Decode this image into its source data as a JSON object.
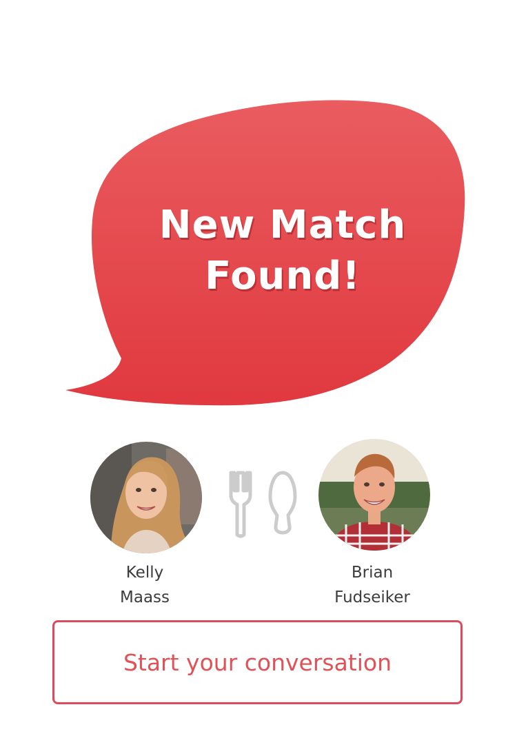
{
  "match": {
    "headline": "New Match\nFound!"
  },
  "people": [
    {
      "first_name": "Kelly",
      "last_name": "Maass",
      "avatar": "kelly-photo"
    },
    {
      "first_name": "Brian",
      "last_name": "Fudseiker",
      "avatar": "brian-photo"
    }
  ],
  "icons": {
    "center": "fork-and-spoon-icon"
  },
  "actions": {
    "start_label": "Start your conversation"
  },
  "colors": {
    "bubble_red": "#e3464d",
    "accent_text": "#e05257",
    "button_border": "#d94c5f",
    "utensil_gray": "#cccccc"
  }
}
